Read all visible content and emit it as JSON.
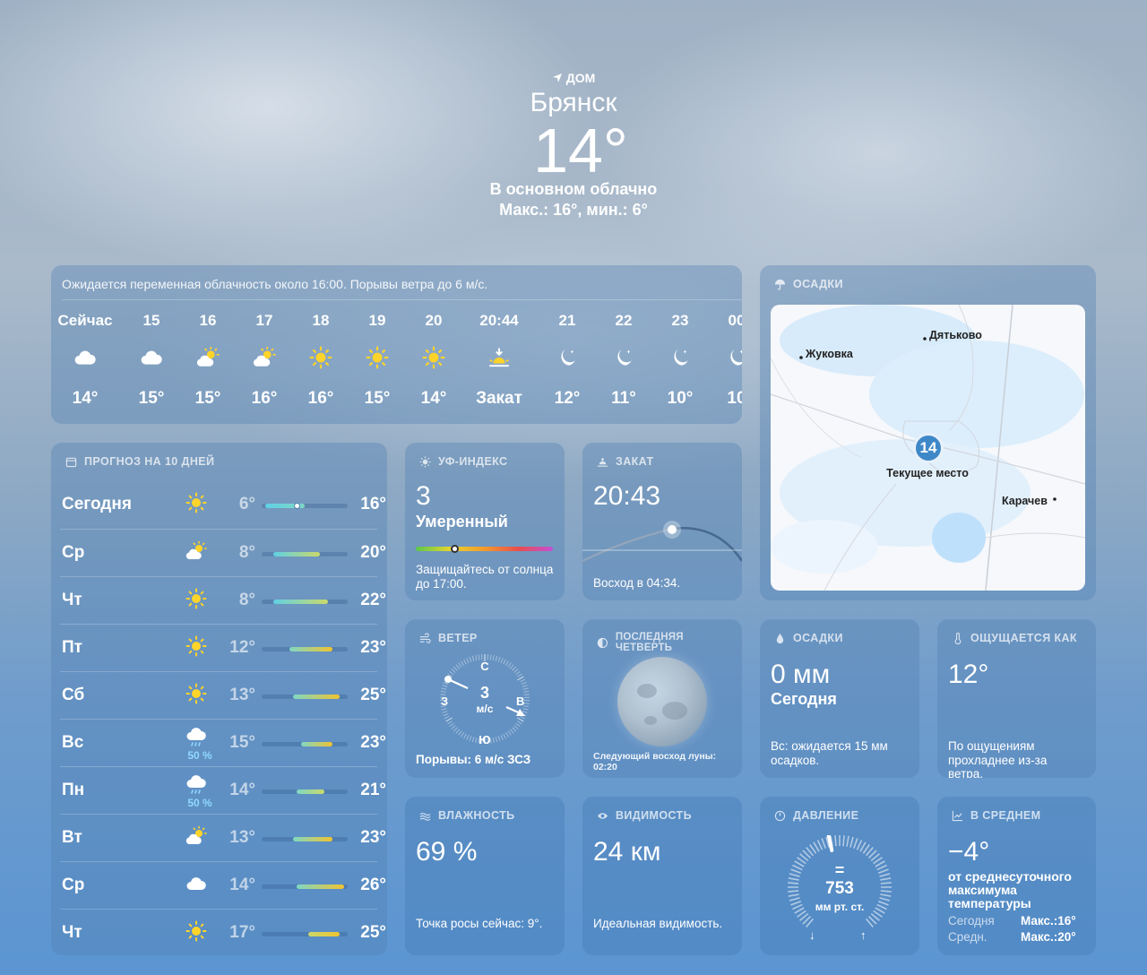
{
  "header": {
    "location_label": "ДОМ",
    "city": "Брянск",
    "temp": "14°",
    "condition": "В основном облачно",
    "range": "Макс.: 16°, мин.: 6°"
  },
  "hourly": {
    "summary": "Ожидается переменная облачность около 16:00. Порывы ветра до 6 м/с.",
    "items": [
      {
        "time": "Сейчас",
        "icon": "cloud-icon",
        "value": "14°"
      },
      {
        "time": "15",
        "icon": "cloud-icon",
        "value": "15°"
      },
      {
        "time": "16",
        "icon": "partly-sunny-icon",
        "value": "15°"
      },
      {
        "time": "17",
        "icon": "partly-sunny-icon",
        "value": "16°"
      },
      {
        "time": "18",
        "icon": "sun-icon",
        "value": "16°"
      },
      {
        "time": "19",
        "icon": "sun-icon",
        "value": "15°"
      },
      {
        "time": "20",
        "icon": "sun-icon",
        "value": "14°"
      },
      {
        "time": "20:44",
        "icon": "sunset-icon",
        "value": "Закат"
      },
      {
        "time": "21",
        "icon": "moon-stars-icon",
        "value": "12°"
      },
      {
        "time": "22",
        "icon": "moon-stars-icon",
        "value": "11°"
      },
      {
        "time": "23",
        "icon": "moon-stars-icon",
        "value": "10°"
      },
      {
        "time": "00",
        "icon": "moon-stars-icon",
        "value": "10"
      }
    ]
  },
  "forecast": {
    "title": "ПРОГНОЗ НА 10 ДНЕЙ",
    "days": [
      {
        "day": "Сегодня",
        "icon": "sun-icon",
        "pop": "",
        "low": "6°",
        "high": "16°"
      },
      {
        "day": "Ср",
        "icon": "partly-sunny-icon",
        "pop": "",
        "low": "8°",
        "high": "20°"
      },
      {
        "day": "Чт",
        "icon": "sun-icon",
        "pop": "",
        "low": "8°",
        "high": "22°"
      },
      {
        "day": "Пт",
        "icon": "sun-icon",
        "pop": "",
        "low": "12°",
        "high": "23°"
      },
      {
        "day": "Сб",
        "icon": "sun-icon",
        "pop": "",
        "low": "13°",
        "high": "25°"
      },
      {
        "day": "Вс",
        "icon": "cloud-rain-icon",
        "pop": "50 %",
        "low": "15°",
        "high": "23°"
      },
      {
        "day": "Пн",
        "icon": "cloud-rain-icon",
        "pop": "50 %",
        "low": "14°",
        "high": "21°"
      },
      {
        "day": "Вт",
        "icon": "partly-sunny-icon",
        "pop": "",
        "low": "13°",
        "high": "23°"
      },
      {
        "day": "Ср",
        "icon": "cloud-icon",
        "pop": "",
        "low": "14°",
        "high": "26°"
      },
      {
        "day": "Чт",
        "icon": "sun-icon",
        "pop": "",
        "low": "17°",
        "high": "25°"
      }
    ]
  },
  "uv": {
    "title": "УФ-ИНДЕКС",
    "value": "3",
    "level": "Умеренный",
    "note": "Защищайтесь от солнца до 17:00."
  },
  "sunset": {
    "title": "ЗАКАТ",
    "time": "20:43",
    "sunrise": "Восход в 04:34."
  },
  "precip_map": {
    "title": "ОСАДКИ",
    "places": [
      "Дятьково",
      "Жуковка",
      "Текущее место",
      "Карачев"
    ],
    "marker": "14"
  },
  "wind": {
    "title": "ВЕТЕР",
    "speed": "3",
    "unit": "м/с",
    "n": "С",
    "e": "В",
    "s": "Ю",
    "w": "З",
    "gusts": "Порывы: 6 м/с ЗСЗ"
  },
  "moon": {
    "title": "ПОСЛЕДНЯЯ ЧЕТВЕРТЬ",
    "next": "Следующий восход луны: 02:20"
  },
  "precip": {
    "title": "ОСАДКИ",
    "amount": "0 мм",
    "period": "Сегодня",
    "note": "Вс: ожидается 15 мм осадков."
  },
  "feels": {
    "title": "ОЩУЩАЕТСЯ КАК",
    "value": "12°",
    "note": "По ощущениям прохладнее из-за ветра."
  },
  "humidity": {
    "title": "ВЛАЖНОСТЬ",
    "value": "69 %",
    "note": "Точка росы сейчас: 9°."
  },
  "visibility": {
    "title": "ВИДИМОСТЬ",
    "value": "24 км",
    "note": "Идеальная видимость."
  },
  "pressure": {
    "title": "ДАВЛЕНИЕ",
    "symbol": "=",
    "value": "753",
    "unit": "мм рт. ст."
  },
  "average": {
    "title": "В СРЕДНЕМ",
    "value": "−4°",
    "note": "от среднесуточного максимума температуры",
    "today_label": "Сегодня",
    "today_value": "Макс.:16°",
    "avg_label": "Средн.",
    "avg_value": "Макс.:20°"
  }
}
